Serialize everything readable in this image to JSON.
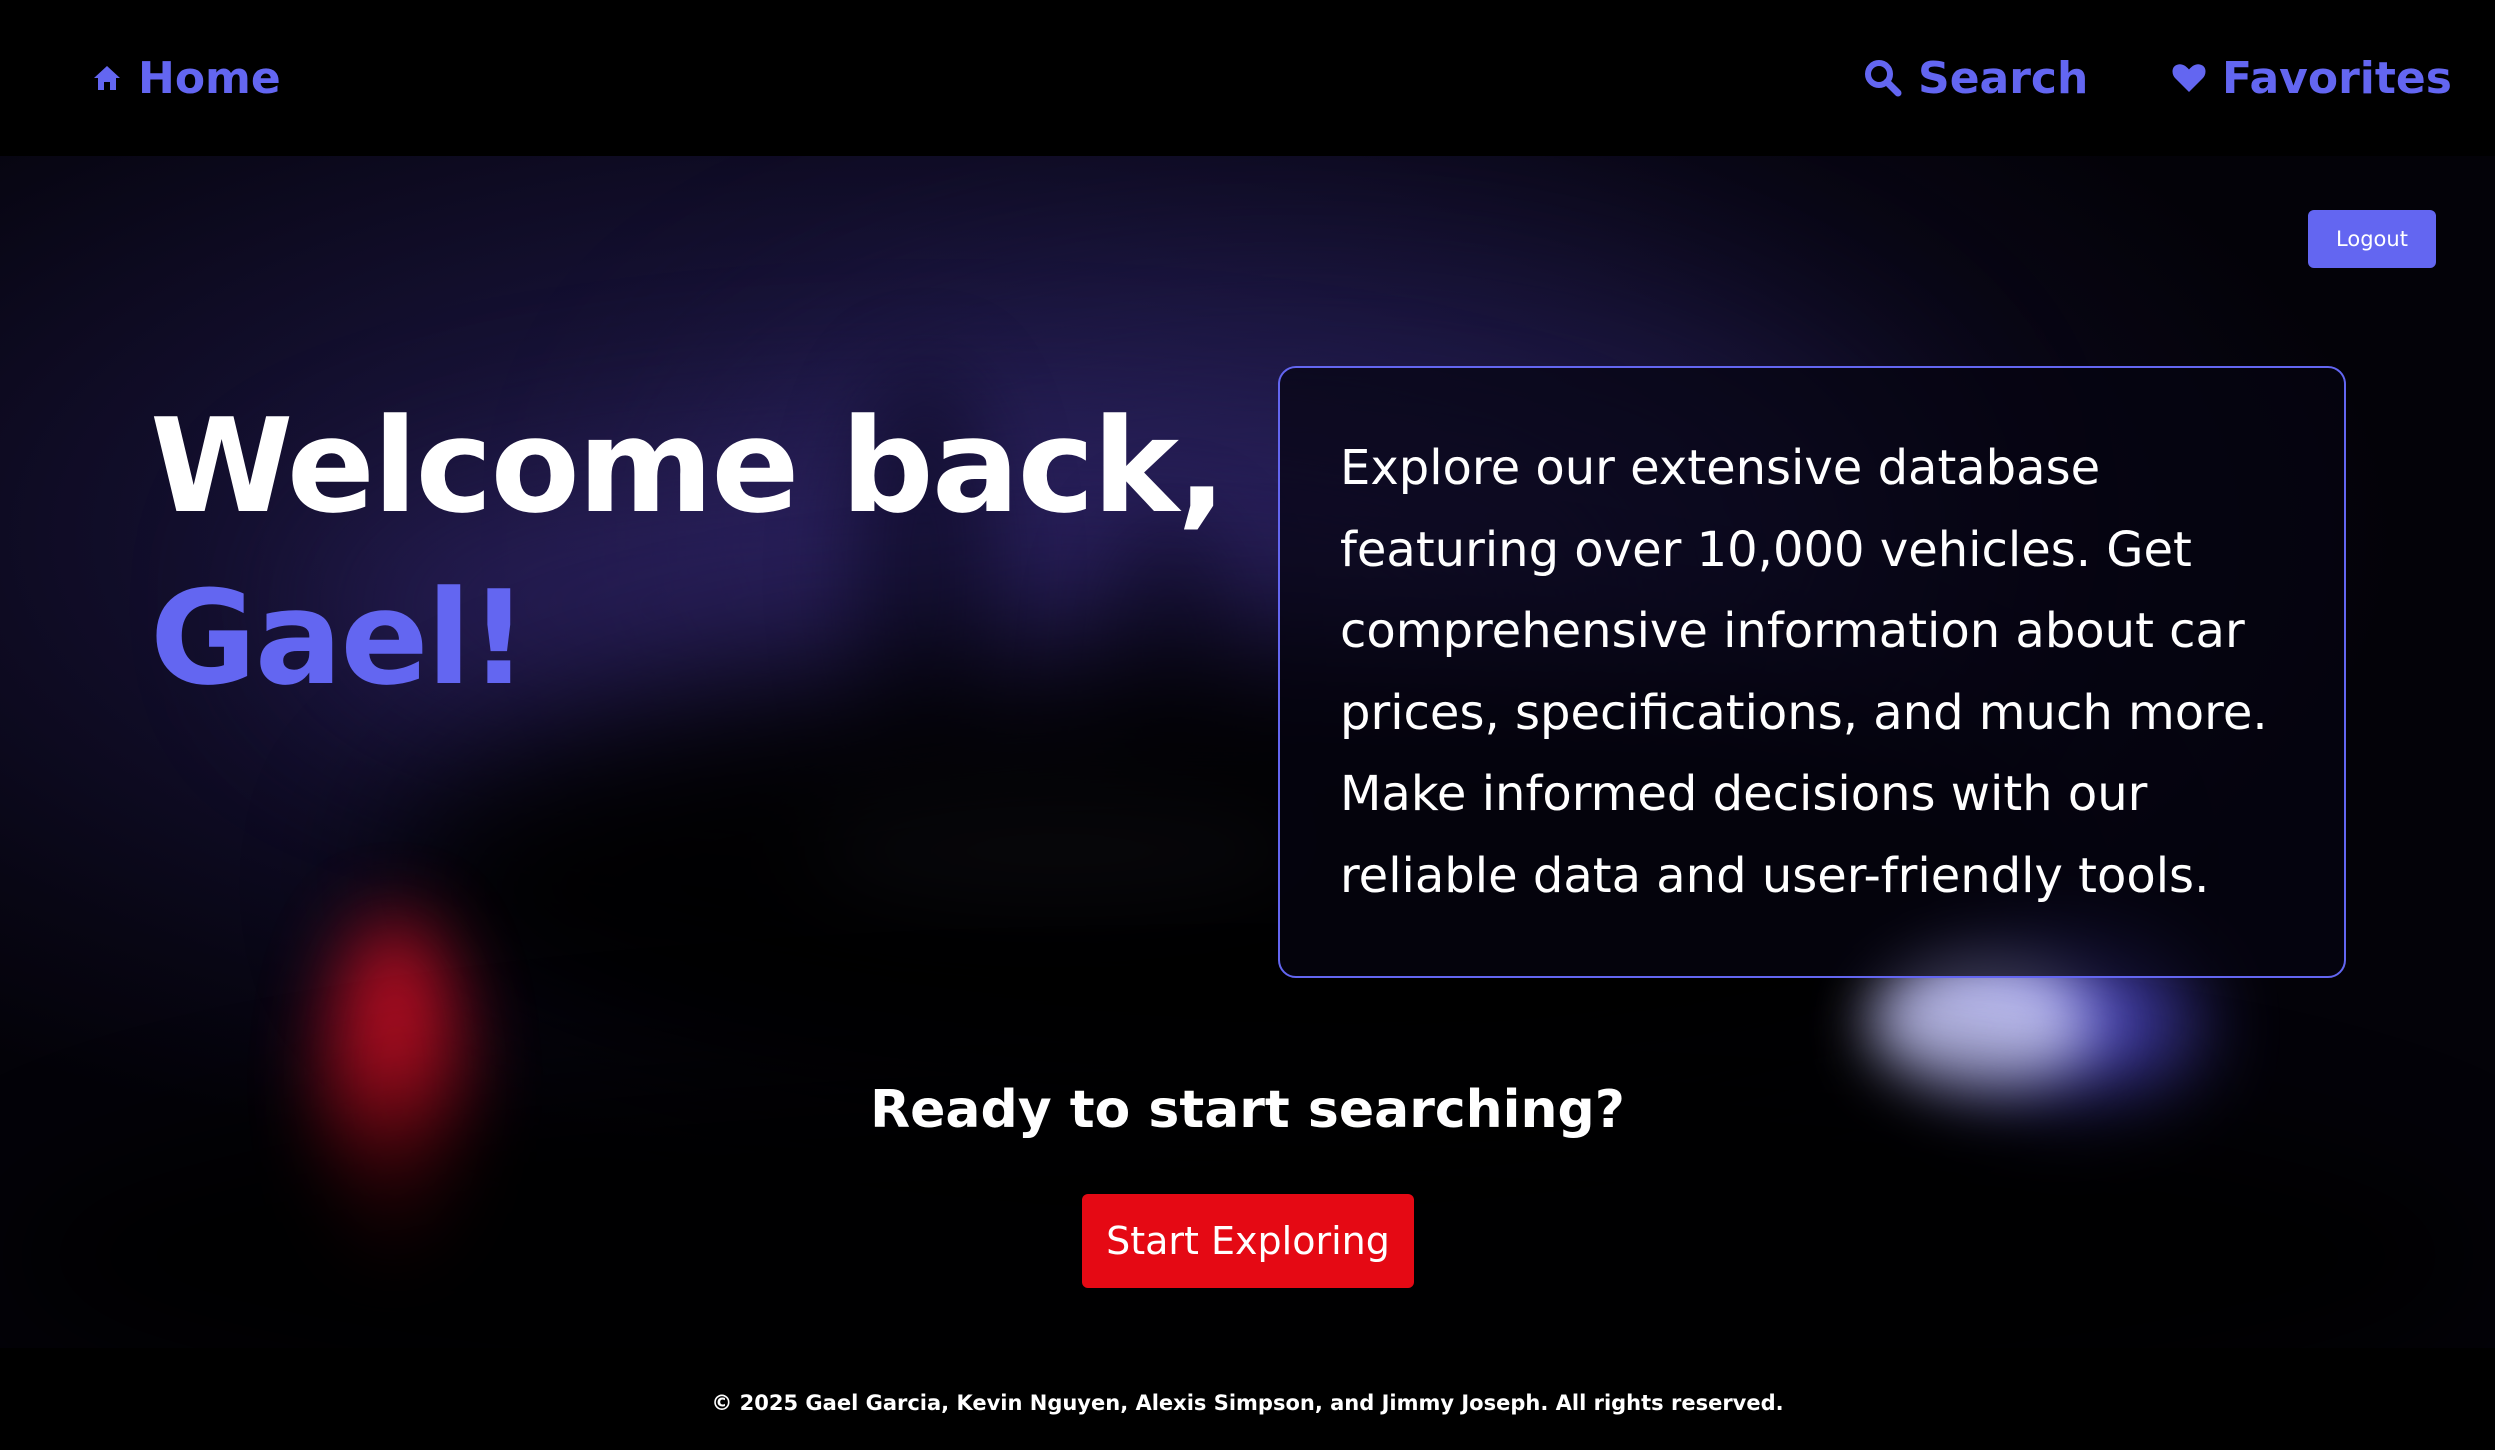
{
  "nav": {
    "home": {
      "label": "Home",
      "icon": "home-icon"
    },
    "search": {
      "label": "Search",
      "icon": "search-icon"
    },
    "favorites": {
      "label": "Favorites",
      "icon": "heart-icon"
    }
  },
  "header": {
    "logout_label": "Logout"
  },
  "hero": {
    "welcome_text": "Welcome back,",
    "user_name": "Gael!",
    "description": "Explore our extensive database featuring over 10,000 vehicles. Get comprehensive information about car prices, specifications, and much more. Make informed decisions with our reliable data and user-friendly tools."
  },
  "cta": {
    "title": "Ready to start searching?",
    "button_label": "Start Exploring"
  },
  "footer": {
    "copyright": "© 2025 Gael Garcia, Kevin Nguyen, Alexis Simpson, and Jimmy Joseph. All rights reserved."
  },
  "colors": {
    "accent": "#6366f1",
    "cta": "#e50914",
    "background": "#000000",
    "text": "#ffffff"
  }
}
